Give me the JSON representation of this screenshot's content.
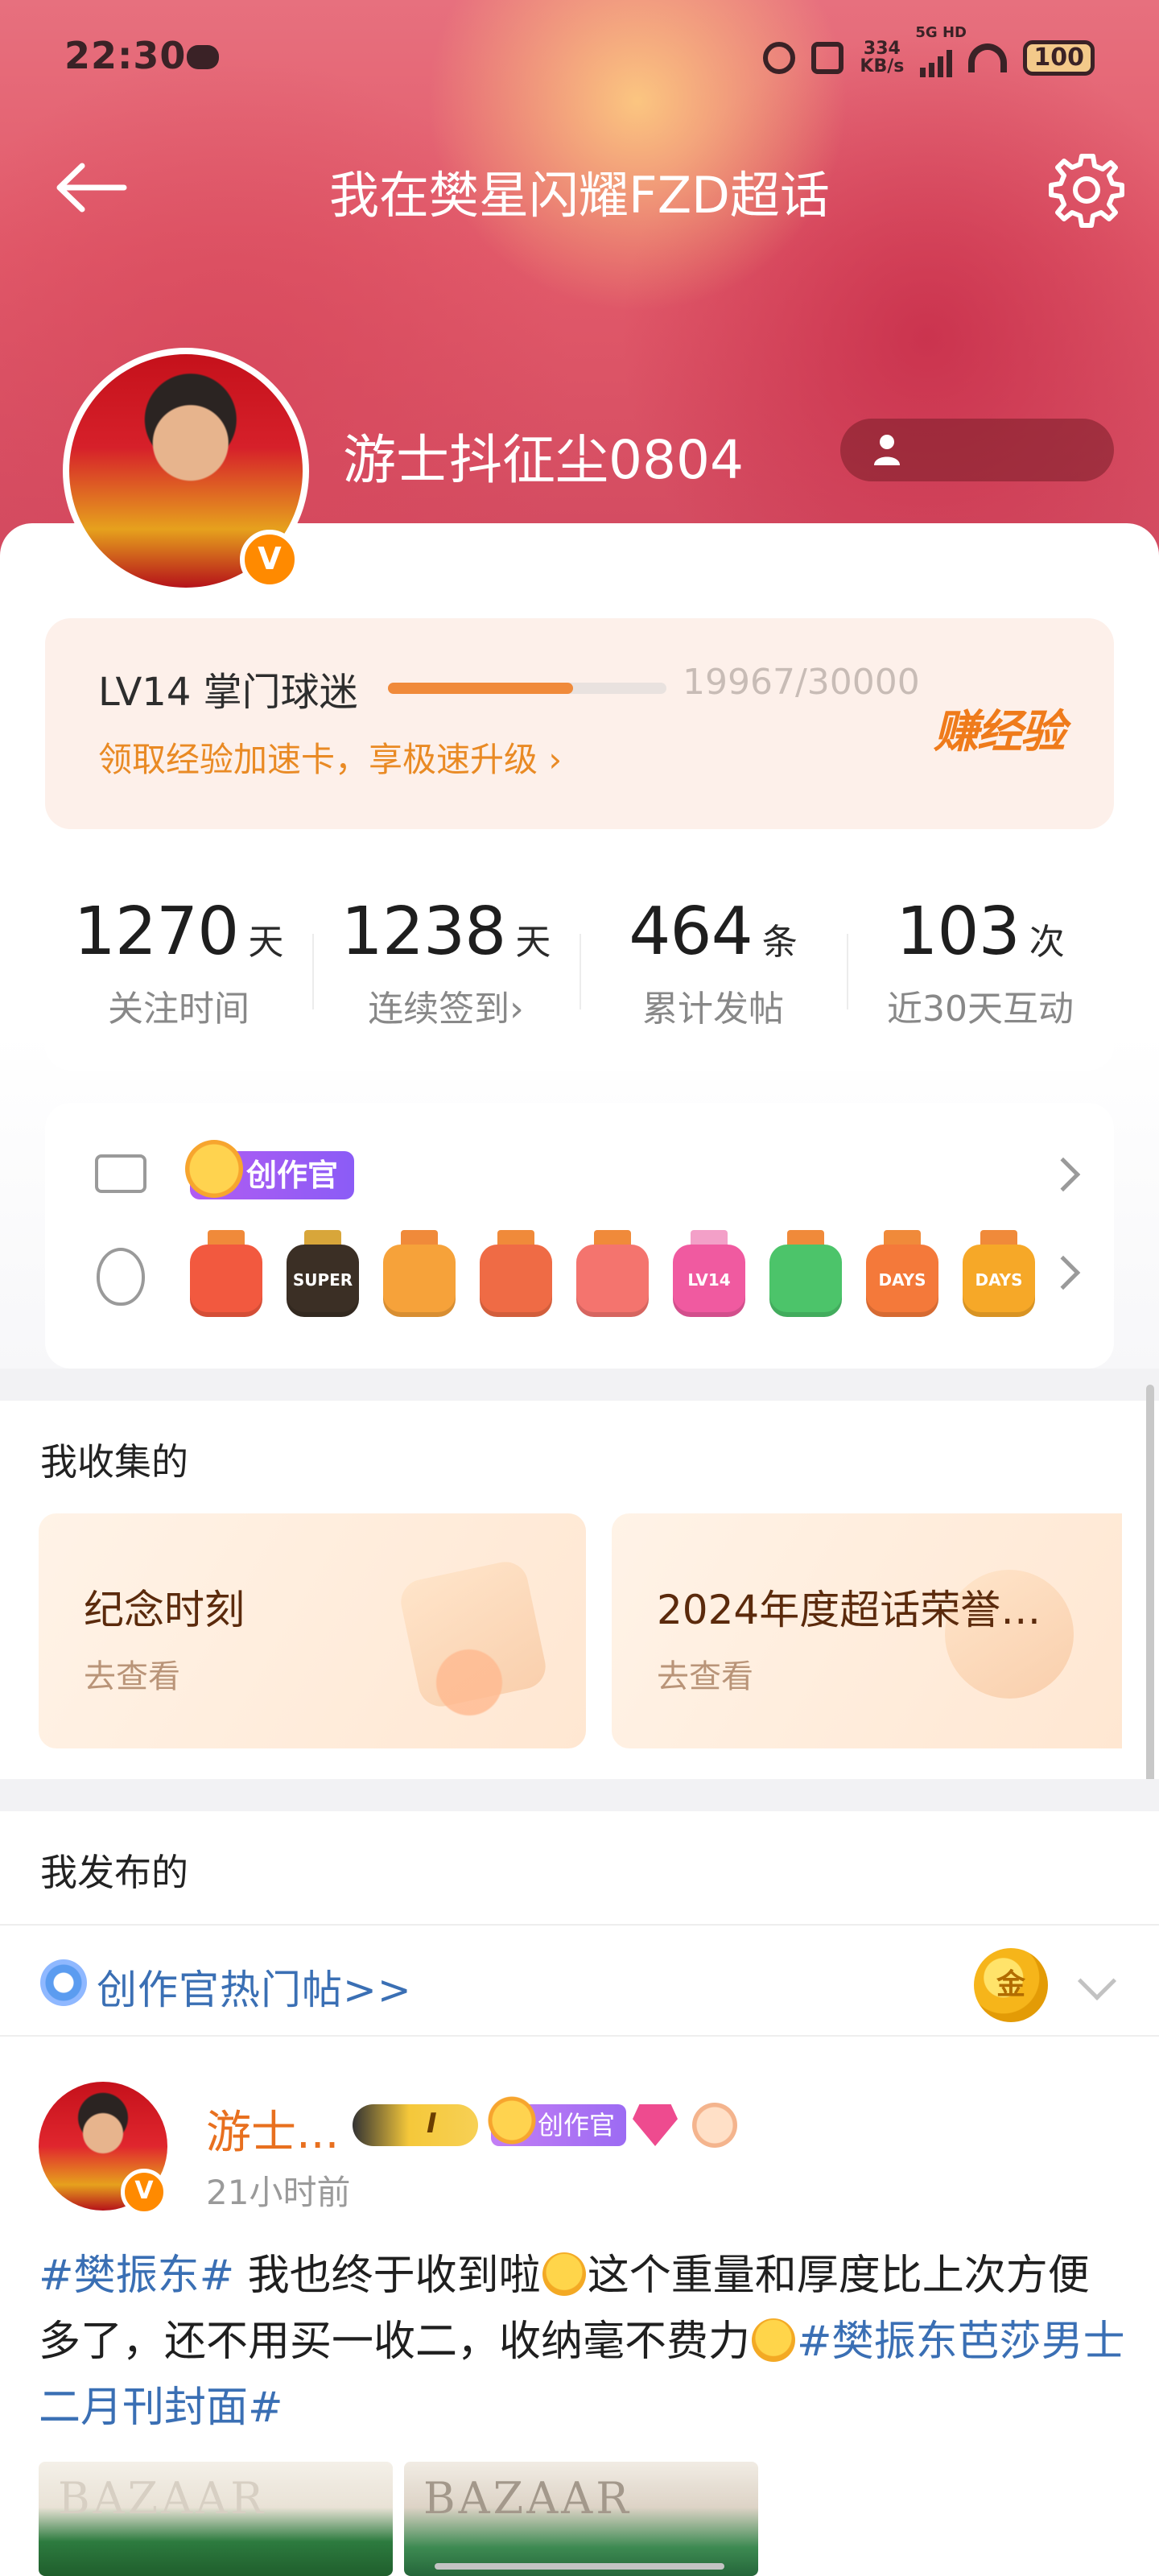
{
  "status_bar": {
    "time": "22:30",
    "speed_value": "334",
    "speed_unit": "KB/s",
    "network": "5G HD",
    "battery": "100"
  },
  "header": {
    "title": "我在樊星闪耀FZD超话",
    "username": "游士抖征尘0804",
    "verified_badge": "V"
  },
  "level": {
    "label": "LV14 掌门球迷",
    "progress_text": "19967/30000",
    "progress_fraction": 0.6656,
    "link": "领取经验加速卡，享极速升级 ›",
    "earn_label": "赚经验",
    "accent_color": "#f08a3a"
  },
  "stats": [
    {
      "value": "1270",
      "unit": "天",
      "label": "关注时间"
    },
    {
      "value": "1238",
      "unit": "天",
      "label": "连续签到›"
    },
    {
      "value": "464",
      "unit": "条",
      "label": "累计发帖"
    },
    {
      "value": "103",
      "unit": "次",
      "label": "近30天互动"
    }
  ],
  "badges": {
    "creator_tag": "创作官",
    "medals": [
      {
        "color": "#f2593f",
        "ribbon": "#f08a3a",
        "text": ""
      },
      {
        "color": "#3b2f25",
        "ribbon": "#d8a63a",
        "text": "SUPER"
      },
      {
        "color": "#f6a23a",
        "ribbon": "#f08a3a",
        "text": ""
      },
      {
        "color": "#ef6b45",
        "ribbon": "#f08a3a",
        "text": ""
      },
      {
        "color": "#f4746e",
        "ribbon": "#f08a3a",
        "text": ""
      },
      {
        "color": "#f05aa0",
        "ribbon": "#f3a0c8",
        "text": "LV14"
      },
      {
        "color": "#4cc46a",
        "ribbon": "#f08a3a",
        "text": ""
      },
      {
        "color": "#f4793a",
        "ribbon": "#f08a3a",
        "text": "DAYS"
      },
      {
        "color": "#f6a828",
        "ribbon": "#f08a3a",
        "text": "DAYS"
      }
    ]
  },
  "collected": {
    "title": "我收集的",
    "cards": [
      {
        "title": "纪念时刻",
        "sub": "去查看"
      },
      {
        "title": "2024年度超话荣誉…",
        "sub": "去查看"
      }
    ]
  },
  "published": {
    "title": "我发布的",
    "hot_link": "创作官热门帖>>",
    "gold_label": "金"
  },
  "post": {
    "name": "游士...",
    "crown_level": "I",
    "creator_tag": "创作官",
    "time": "21小时前",
    "body_tag1": "#樊振东#",
    "body_text1": " 我也终于收到啦",
    "body_text2": "这个重量和厚度比上次方便多了，还不用买一收二，收纳毫不费力",
    "body_tag2": "#樊振东芭莎男士二月刊封面#",
    "image_text_a": "BAZAAR",
    "image_text_b": "BAZAAR"
  }
}
